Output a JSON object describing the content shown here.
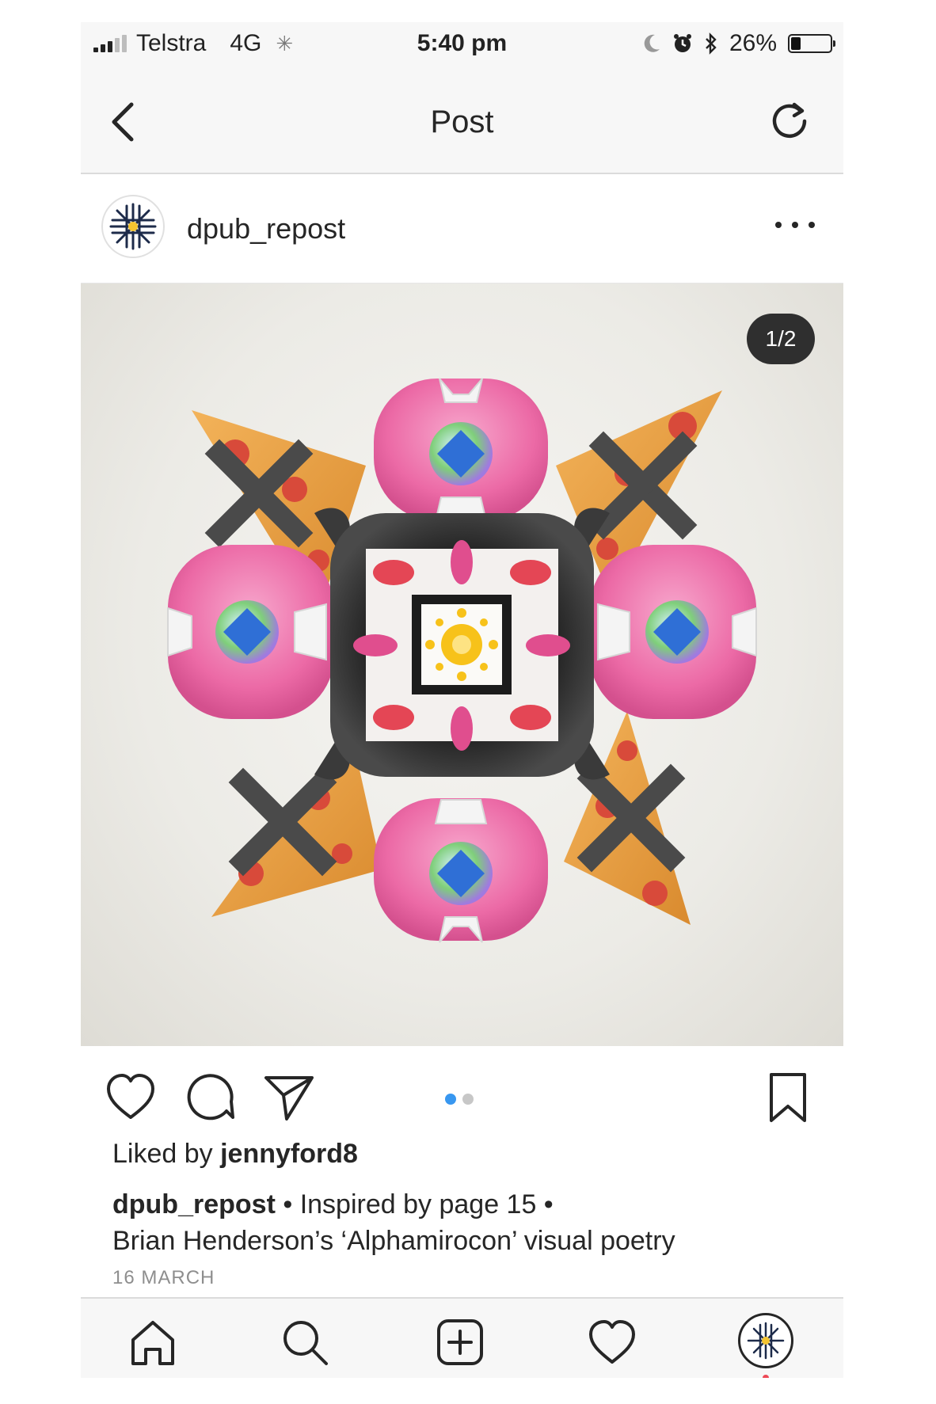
{
  "status_bar": {
    "carrier": "Telstra",
    "network": "4G",
    "time": "5:40 pm",
    "battery": "26%",
    "battery_level": 0.26
  },
  "nav": {
    "title": "Post",
    "back_icon": "chevron-left-icon",
    "refresh_icon": "refresh-icon"
  },
  "post": {
    "username": "dpub_repost",
    "menu_icon": "more-horizontal-icon",
    "image_counter": "1/2",
    "carousel_dots": {
      "count": 2,
      "active": 0
    },
    "liked_by_prefix": "Liked by ",
    "liked_by_user": "jennyford8",
    "caption_user": "dpub_repost",
    "caption_text_line1": " • Inspired by page 15 •",
    "caption_text_line2": "Brian Henderson’s ‘Alphamirocon’ visual poetry",
    "date": "16 MARCH"
  },
  "actions": {
    "like_icon": "heart-icon",
    "comment_icon": "comment-icon",
    "share_icon": "send-icon",
    "save_icon": "bookmark-icon"
  },
  "tab_bar": {
    "home_icon": "home-icon",
    "search_icon": "search-icon",
    "add_icon": "add-post-icon",
    "activity_icon": "heart-icon",
    "profile_icon": "profile-avatar"
  },
  "colors": {
    "dot_active": "#3897f0",
    "dot_inactive": "#c7c7c7",
    "notification_dot": "#ed4956",
    "pink": "#ee6fa8",
    "crust": "#e79a3c",
    "pepperoni": "#d84a3a"
  }
}
